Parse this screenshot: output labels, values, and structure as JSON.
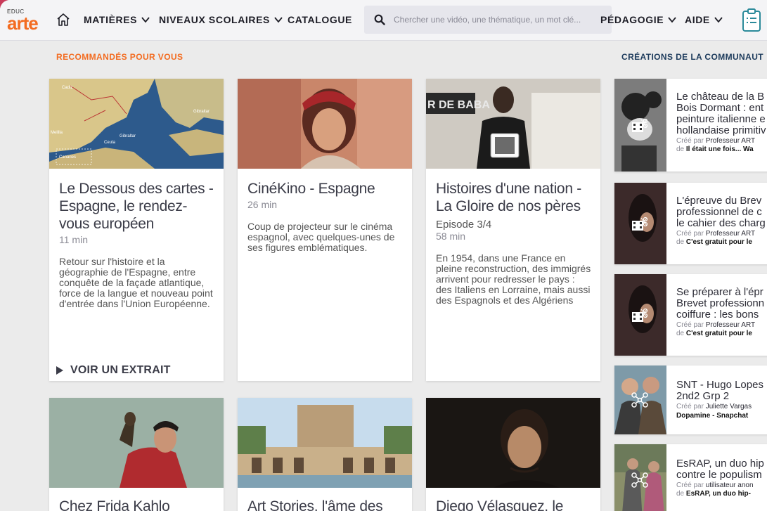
{
  "nav": {
    "logo_small": "EDUC",
    "logo_main": "arte",
    "items": [
      {
        "label": "MATIÈRES"
      },
      {
        "label": "NIVEAUX SCOLAIRES"
      },
      {
        "label": "CATALOGUE"
      },
      {
        "label": "PÉDAGOGIE"
      },
      {
        "label": "AIDE"
      }
    ],
    "search_placeholder": "Chercher une vidéo, une thématique, un mot clé..."
  },
  "recommended": {
    "title": "RECOMMANDÉS POUR VOUS",
    "title_color": "#f36c21",
    "cards": [
      {
        "title": "Le Dessous des cartes - Espagne, le rendez-vous européen",
        "duration": "11 min",
        "description": "Retour sur l'histoire et la géographie de l'Espagne, entre conquête de la façade atlantique, force de la langue et nouveau point d'entrée dans l'Union Européenne.",
        "cta": "VOIR UN EXTRAIT",
        "map_labels": [
          "Cadiz",
          "Gibraltar",
          "Ceuta",
          "Melilla",
          "Canaries",
          "Gibraltar"
        ]
      },
      {
        "title": "CinéKino - Espagne",
        "duration": "26 min",
        "description": "Coup de projecteur sur le cinéma espagnol, avec quelques-unes de ses figures emblématiques."
      },
      {
        "title": "Histoires d'une nation - La Gloire de nos pères",
        "episode": "Episode 3/4",
        "duration": "58 min",
        "description": "En 1954, dans une France en pleine reconstruction, des immigrés arrivent pour redresser le pays : des Italiens en Lorraine, mais aussi des Espagnols et des Algériens",
        "shop_sign": "R DE BABA"
      }
    ],
    "bottom_cards": [
      {
        "title": "Chez Frida Kahlo"
      },
      {
        "title": "Art Stories, l'âme des"
      },
      {
        "title": "Diego Vélasquez, le"
      }
    ]
  },
  "community": {
    "title": "CRÉATIONS DE LA COMMUNAUT",
    "title_color": "#1d3b5c",
    "created_prefix": "Créé par",
    "source_prefix": "de",
    "items": [
      {
        "lines": [
          "Le château de la B",
          "Bois Dormant : ent",
          "peinture italienne e",
          "hollandaise primitiv"
        ],
        "author": "Professeur ART",
        "source": "Il était une fois... Wa",
        "icon": "film-cut-icon"
      },
      {
        "lines": [
          "L'épreuve du Brev",
          "professionnel de c",
          "le cahier des charg"
        ],
        "author": "Professeur ART",
        "source": "C'est gratuit pour le",
        "icon": "film-cut-icon"
      },
      {
        "lines": [
          "Se préparer à l'épr",
          "Brevet professionn",
          "coiffure : les bons"
        ],
        "author": "Professeur ART",
        "source": "C'est gratuit pour le",
        "icon": "film-cut-icon"
      },
      {
        "lines": [
          "SNT - Hugo Lopes",
          "2nd2 Grp 2"
        ],
        "author": "Juliette Vargas",
        "source": "Dopamine - Snapchat",
        "icon": "network-icon"
      },
      {
        "lines": [
          "EsRAP, un duo hip",
          "contre le populism"
        ],
        "author": "utilisateur anon",
        "source": "EsRAP, un duo hip-",
        "icon": "network-icon"
      }
    ]
  }
}
